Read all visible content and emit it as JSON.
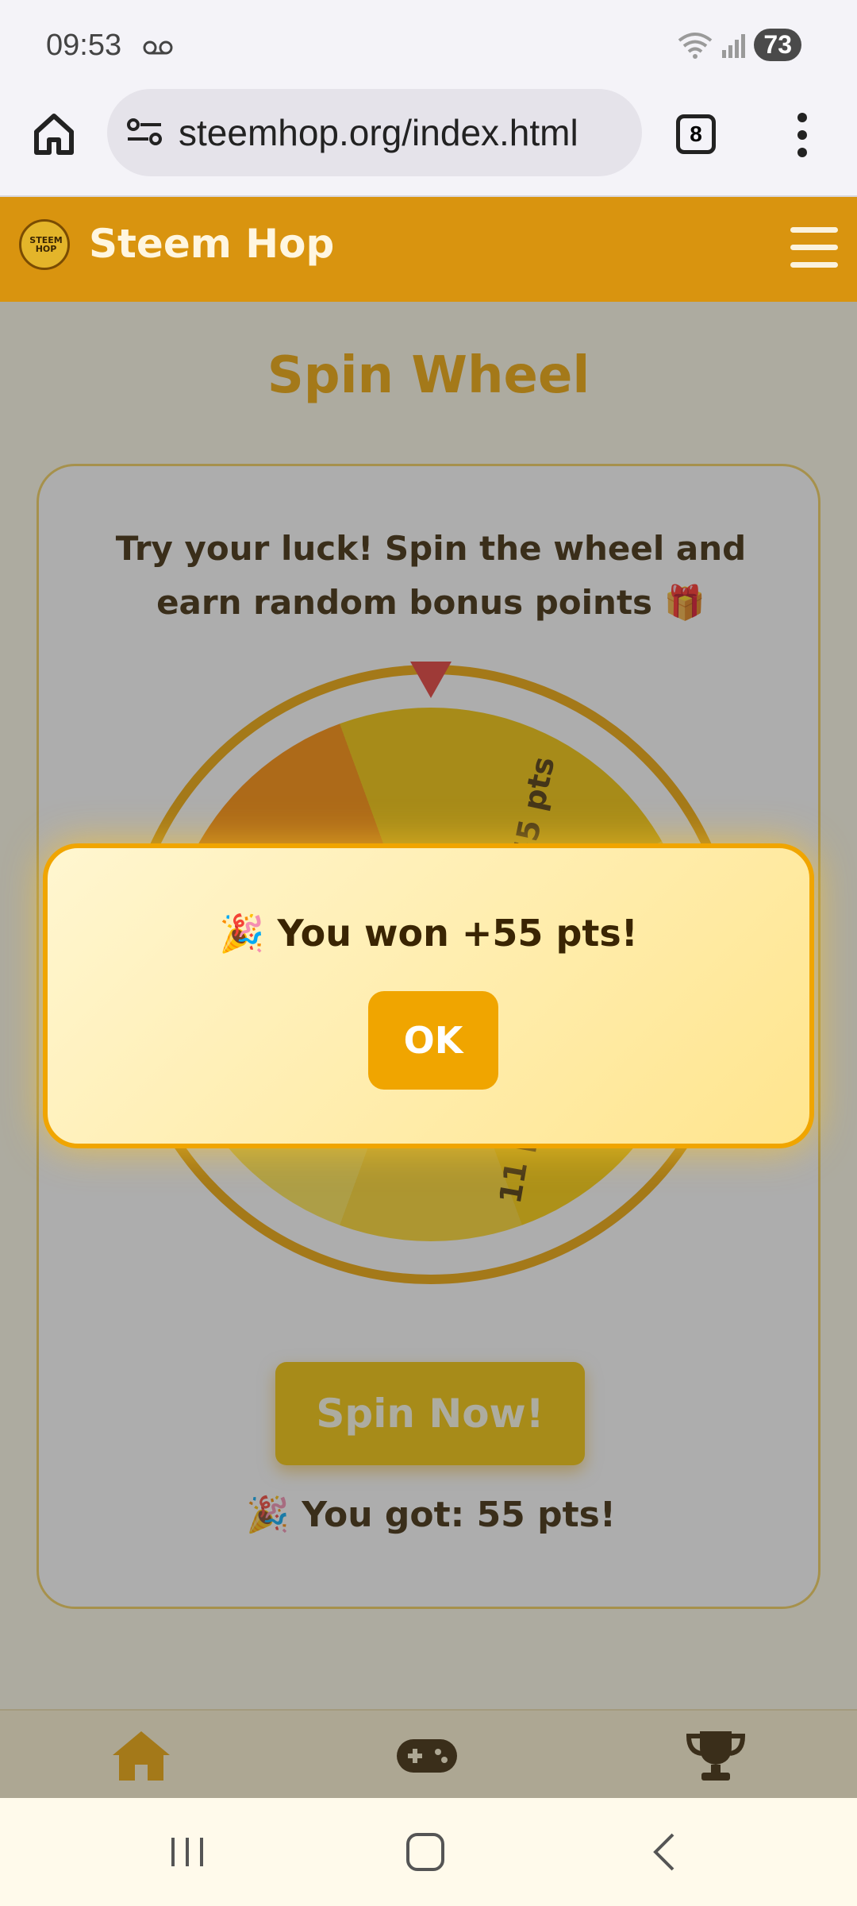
{
  "status_bar": {
    "time": "09:53",
    "battery": "73"
  },
  "browser": {
    "url": "steemhop.org/index.html",
    "tab_count": "8"
  },
  "app": {
    "title": "Steem Hop",
    "logo_text": "STEEM HOP"
  },
  "page": {
    "title": "Spin Wheel",
    "description": "Try your luck! Spin the wheel and earn random bonus points 🎁",
    "wheel_labels": [
      "55 pts",
      "11 pts"
    ],
    "spin_button": "Spin Now!",
    "result": "🎉 You got: 55 pts!"
  },
  "dialog": {
    "message": "🎉 You won +55 pts!",
    "ok_label": "OK"
  },
  "bottom_nav": [
    "home-icon",
    "gamepad-icon",
    "trophy-icon"
  ],
  "colors": {
    "accent": "#f0a500",
    "header": "#d9940f",
    "text": "#3a2503"
  }
}
